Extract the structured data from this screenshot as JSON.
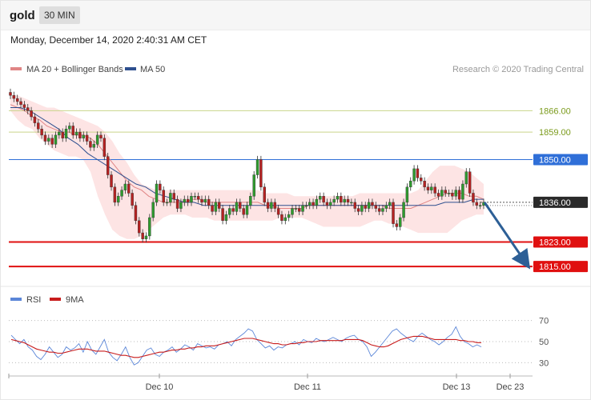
{
  "header": {
    "asset": "gold",
    "timeframe": "30 MIN",
    "datetime": "Monday, December 14, 2020 2:40:31 AM CET"
  },
  "legend": {
    "ma20": "MA 20 + Bollinger Bands",
    "ma50": "MA 50",
    "credit": "Research © 2020 Trading Central"
  },
  "rsi_legend": {
    "rsi": "RSI",
    "ma9": "9MA"
  },
  "colors": {
    "bull": "#2e9b2e",
    "bear": "#b52121",
    "ma50": "#2e4f8f",
    "ma20": "#e08585",
    "band": "#fde4e4",
    "support": "#e01010",
    "pivot": "#2f6fd8",
    "resistance": "#7a9a1a",
    "arrow": "#2d5f96",
    "rsi": "#5b86d8",
    "rsi_ma": "#c81c1c"
  },
  "chart_data": [
    {
      "type": "candlestick",
      "instrument": "gold",
      "interval": "30 MIN",
      "ylim": [
        1809,
        1875
      ],
      "x_ticks": [
        "Dec 10",
        "Dec 11",
        "Dec 13",
        "Dec 23"
      ],
      "levels": [
        {
          "value": 1866.0,
          "label": "1866.00",
          "role": "resistance"
        },
        {
          "value": 1859.0,
          "label": "1859.00",
          "role": "resistance"
        },
        {
          "value": 1850.0,
          "label": "1850.00",
          "role": "pivot"
        },
        {
          "value": 1836.0,
          "label": "1836.00",
          "role": "last"
        },
        {
          "value": 1823.0,
          "label": "1823.00",
          "role": "support"
        },
        {
          "value": 1815.0,
          "label": "1815.00",
          "role": "support"
        }
      ],
      "close": [
        1871,
        1870,
        1869,
        1868,
        1867,
        1866,
        1864,
        1862,
        1860,
        1858,
        1856,
        1857,
        1855,
        1858,
        1859,
        1857,
        1860,
        1861,
        1858,
        1859,
        1857,
        1858,
        1856,
        1854,
        1855,
        1858,
        1857,
        1851,
        1845,
        1841,
        1836,
        1838,
        1840,
        1842,
        1839,
        1835,
        1830,
        1826,
        1824,
        1825,
        1831,
        1836,
        1842,
        1840,
        1836,
        1836,
        1839,
        1837,
        1834,
        1836,
        1837,
        1836,
        1838,
        1838,
        1837,
        1836,
        1837,
        1835,
        1833,
        1836,
        1834,
        1830,
        1832,
        1834,
        1833,
        1836,
        1834,
        1832,
        1835,
        1838,
        1845,
        1850,
        1841,
        1836,
        1834,
        1836,
        1834,
        1832,
        1830,
        1831,
        1832,
        1834,
        1834,
        1833,
        1835,
        1835,
        1836,
        1835,
        1837,
        1838,
        1836,
        1835,
        1836,
        1837,
        1838,
        1836,
        1837,
        1836,
        1836,
        1834,
        1833,
        1835,
        1834,
        1836,
        1835,
        1834,
        1833,
        1834,
        1835,
        1836,
        1829,
        1828,
        1831,
        1836,
        1841,
        1843,
        1847,
        1844,
        1843,
        1841,
        1840,
        1841,
        1839,
        1838,
        1840,
        1839,
        1839,
        1838,
        1840,
        1837,
        1842,
        1846,
        1839,
        1836,
        1835,
        1835,
        1836
      ],
      "ma20": [
        1868,
        1867,
        1866,
        1864,
        1863,
        1861,
        1860,
        1859,
        1859,
        1858,
        1858,
        1857,
        1855,
        1852,
        1849,
        1846,
        1843,
        1841,
        1840,
        1838,
        1837,
        1836,
        1836,
        1836,
        1836,
        1837,
        1837,
        1836,
        1836,
        1836,
        1836,
        1836,
        1836,
        1836,
        1836,
        1835,
        1835,
        1834,
        1834,
        1834,
        1834,
        1835,
        1835,
        1835,
        1835,
        1835,
        1835,
        1835,
        1835,
        1835,
        1835,
        1835,
        1834,
        1834,
        1834,
        1834,
        1835,
        1836,
        1837,
        1838,
        1839,
        1839,
        1839,
        1838,
        1838,
        1837
      ],
      "bb_upper": [
        1871,
        1871,
        1870,
        1869,
        1868,
        1867,
        1867,
        1866,
        1865,
        1864,
        1863,
        1862,
        1861,
        1859,
        1856,
        1852,
        1849,
        1845,
        1842,
        1841,
        1840,
        1840,
        1840,
        1840,
        1840,
        1840,
        1840,
        1840,
        1840,
        1840,
        1840,
        1840,
        1840,
        1840,
        1840,
        1839,
        1839,
        1839,
        1839,
        1838,
        1838,
        1838,
        1838,
        1838,
        1838,
        1838,
        1838,
        1838,
        1839,
        1839,
        1839,
        1839,
        1839,
        1839,
        1839,
        1839,
        1840,
        1843,
        1846,
        1848,
        1848,
        1848,
        1847,
        1846,
        1844,
        1842
      ],
      "bb_lower": [
        1866,
        1863,
        1861,
        1860,
        1857,
        1855,
        1853,
        1852,
        1851,
        1851,
        1850,
        1846,
        1838,
        1832,
        1827,
        1825,
        1824,
        1824,
        1825,
        1827,
        1829,
        1831,
        1832,
        1832,
        1832,
        1831,
        1831,
        1831,
        1830,
        1830,
        1830,
        1830,
        1830,
        1830,
        1830,
        1830,
        1830,
        1831,
        1831,
        1831,
        1831,
        1830,
        1829,
        1828,
        1828,
        1828,
        1828,
        1828,
        1828,
        1829,
        1830,
        1830,
        1829,
        1829,
        1828,
        1827,
        1826,
        1826,
        1826,
        1826,
        1826,
        1828,
        1830,
        1831,
        1832,
        1832
      ],
      "ma50": [
        1867,
        1867,
        1866,
        1864,
        1862,
        1860,
        1857,
        1855,
        1852,
        1850,
        1848,
        1846,
        1844,
        1842,
        1841,
        1839,
        1838,
        1837,
        1836,
        1836,
        1835,
        1835,
        1835,
        1835,
        1835,
        1835,
        1835,
        1835,
        1835,
        1835,
        1835,
        1835,
        1835,
        1835,
        1835,
        1835,
        1835,
        1835,
        1835,
        1835,
        1835,
        1835,
        1835,
        1835,
        1835,
        1836,
        1836,
        1836,
        1837,
        1837
      ],
      "forecast_arrow": {
        "from": 1836,
        "to": 1815,
        "direction": "down"
      }
    },
    {
      "type": "line",
      "name": "RSI",
      "ylim": [
        22,
        78
      ],
      "y_ticks": [
        70,
        50,
        30
      ],
      "x_ticks": [
        "Dec 10",
        "Dec 11",
        "Dec 13",
        "Dec 23"
      ],
      "series": [
        {
          "name": "RSI",
          "values": [
            56,
            52,
            48,
            52,
            45,
            42,
            36,
            33,
            38,
            45,
            40,
            35,
            38,
            45,
            42,
            44,
            48,
            40,
            50,
            42,
            38,
            45,
            52,
            40,
            35,
            32,
            38,
            45,
            35,
            28,
            30,
            36,
            42,
            44,
            38,
            36,
            40,
            42,
            45,
            40,
            43,
            47,
            45,
            42,
            48,
            46,
            44,
            45,
            43,
            47,
            48,
            50,
            46,
            52,
            55,
            58,
            62,
            60,
            52,
            48,
            44,
            46,
            42,
            45,
            44,
            47,
            48,
            50,
            47,
            52,
            50,
            49,
            53,
            51,
            50,
            52,
            54,
            52,
            50,
            53,
            55,
            56,
            52,
            50,
            45,
            36,
            40,
            45,
            50,
            55,
            60,
            62,
            58,
            55,
            52,
            50,
            55,
            58,
            55,
            52,
            50,
            47,
            50,
            54,
            57,
            64,
            55,
            50,
            48,
            45,
            47,
            45
          ]
        },
        {
          "name": "9MA",
          "values": [
            52,
            51,
            50,
            49,
            47,
            45,
            43,
            42,
            41,
            40,
            40,
            39,
            39,
            40,
            41,
            42,
            43,
            43,
            43,
            42,
            41,
            41,
            41,
            40,
            39,
            38,
            37,
            37,
            36,
            35,
            35,
            36,
            37,
            38,
            39,
            40,
            40,
            41,
            42,
            42,
            43,
            43,
            44,
            44,
            45,
            45,
            46,
            46,
            46,
            47,
            48,
            49,
            50,
            51,
            52,
            53,
            53,
            53,
            52,
            51,
            50,
            49,
            48,
            48,
            47,
            47,
            48,
            48,
            49,
            49,
            50,
            50,
            50,
            51,
            51,
            51,
            51,
            51,
            51,
            52,
            52,
            52,
            52,
            51,
            49,
            47,
            46,
            45,
            45,
            46,
            48,
            50,
            52,
            53,
            54,
            55,
            55,
            55,
            54,
            53,
            52,
            52,
            52,
            52,
            52,
            52,
            51,
            51,
            50,
            50,
            49,
            49
          ]
        }
      ]
    }
  ]
}
